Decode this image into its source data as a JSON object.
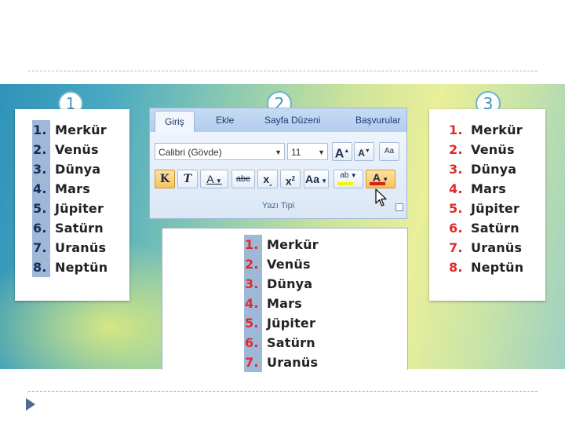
{
  "badges": [
    "1",
    "2",
    "3"
  ],
  "lists": {
    "left": [
      {
        "num": "1.",
        "name": "Merkür"
      },
      {
        "num": "2.",
        "name": "Venüs"
      },
      {
        "num": "3.",
        "name": "Dünya"
      },
      {
        "num": "4.",
        "name": "Mars"
      },
      {
        "num": "5.",
        "name": "Jüpiter"
      },
      {
        "num": "6.",
        "name": "Satürn"
      },
      {
        "num": "7.",
        "name": "Uranüs"
      },
      {
        "num": "8.",
        "name": "Neptün"
      }
    ],
    "document": [
      {
        "num": "1.",
        "name": "Merkür"
      },
      {
        "num": "2.",
        "name": "Venüs"
      },
      {
        "num": "3.",
        "name": "Dünya"
      },
      {
        "num": "4.",
        "name": "Mars"
      },
      {
        "num": "5.",
        "name": "Jüpiter"
      },
      {
        "num": "6.",
        "name": "Satürn"
      },
      {
        "num": "7.",
        "name": "Uranüs"
      }
    ],
    "right": [
      {
        "num": "1.",
        "name": "Merkür"
      },
      {
        "num": "2.",
        "name": "Venüs"
      },
      {
        "num": "3.",
        "name": "Dünya"
      },
      {
        "num": "4.",
        "name": "Mars"
      },
      {
        "num": "5.",
        "name": "Jüpiter"
      },
      {
        "num": "6.",
        "name": "Satürn"
      },
      {
        "num": "7.",
        "name": "Uranüs"
      },
      {
        "num": "8.",
        "name": "Neptün"
      }
    ]
  },
  "ribbon": {
    "tabs": [
      "Giriş",
      "Ekle",
      "Sayfa Düzeni",
      "Başvurular"
    ],
    "font_name": "Calibri (Gövde)",
    "font_size": "11",
    "grow_font": "A",
    "shrink_font": "A",
    "clear_format": "Aa",
    "bold": "K",
    "italic": "T",
    "underline": "A",
    "strikethrough": "abe",
    "subscript": "x",
    "superscript": "x",
    "change_case": "Aa",
    "highlight_label": "ab",
    "font_color_label": "A",
    "group_label": "Yazı Tipi"
  },
  "colors": {
    "highlight_number": "#9fb8d8",
    "red_number": "#e02a2a",
    "font_color_bar": "#d81e1e",
    "highlight_bar": "#f5f500"
  }
}
